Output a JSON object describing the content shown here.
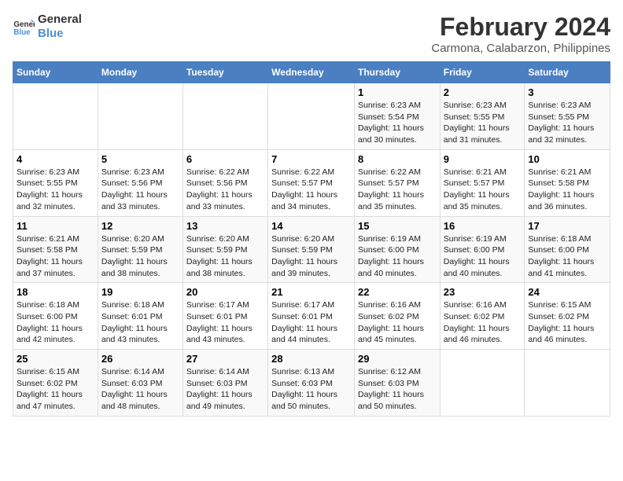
{
  "logo": {
    "line1": "General",
    "line2": "Blue"
  },
  "title": "February 2024",
  "subtitle": "Carmona, Calabarzon, Philippines",
  "days_of_week": [
    "Sunday",
    "Monday",
    "Tuesday",
    "Wednesday",
    "Thursday",
    "Friday",
    "Saturday"
  ],
  "weeks": [
    [
      {
        "day": "",
        "info": ""
      },
      {
        "day": "",
        "info": ""
      },
      {
        "day": "",
        "info": ""
      },
      {
        "day": "",
        "info": ""
      },
      {
        "day": "1",
        "info": "Sunrise: 6:23 AM\nSunset: 5:54 PM\nDaylight: 11 hours\nand 30 minutes."
      },
      {
        "day": "2",
        "info": "Sunrise: 6:23 AM\nSunset: 5:55 PM\nDaylight: 11 hours\nand 31 minutes."
      },
      {
        "day": "3",
        "info": "Sunrise: 6:23 AM\nSunset: 5:55 PM\nDaylight: 11 hours\nand 32 minutes."
      }
    ],
    [
      {
        "day": "4",
        "info": "Sunrise: 6:23 AM\nSunset: 5:55 PM\nDaylight: 11 hours\nand 32 minutes."
      },
      {
        "day": "5",
        "info": "Sunrise: 6:23 AM\nSunset: 5:56 PM\nDaylight: 11 hours\nand 33 minutes."
      },
      {
        "day": "6",
        "info": "Sunrise: 6:22 AM\nSunset: 5:56 PM\nDaylight: 11 hours\nand 33 minutes."
      },
      {
        "day": "7",
        "info": "Sunrise: 6:22 AM\nSunset: 5:57 PM\nDaylight: 11 hours\nand 34 minutes."
      },
      {
        "day": "8",
        "info": "Sunrise: 6:22 AM\nSunset: 5:57 PM\nDaylight: 11 hours\nand 35 minutes."
      },
      {
        "day": "9",
        "info": "Sunrise: 6:21 AM\nSunset: 5:57 PM\nDaylight: 11 hours\nand 35 minutes."
      },
      {
        "day": "10",
        "info": "Sunrise: 6:21 AM\nSunset: 5:58 PM\nDaylight: 11 hours\nand 36 minutes."
      }
    ],
    [
      {
        "day": "11",
        "info": "Sunrise: 6:21 AM\nSunset: 5:58 PM\nDaylight: 11 hours\nand 37 minutes."
      },
      {
        "day": "12",
        "info": "Sunrise: 6:20 AM\nSunset: 5:59 PM\nDaylight: 11 hours\nand 38 minutes."
      },
      {
        "day": "13",
        "info": "Sunrise: 6:20 AM\nSunset: 5:59 PM\nDaylight: 11 hours\nand 38 minutes."
      },
      {
        "day": "14",
        "info": "Sunrise: 6:20 AM\nSunset: 5:59 PM\nDaylight: 11 hours\nand 39 minutes."
      },
      {
        "day": "15",
        "info": "Sunrise: 6:19 AM\nSunset: 6:00 PM\nDaylight: 11 hours\nand 40 minutes."
      },
      {
        "day": "16",
        "info": "Sunrise: 6:19 AM\nSunset: 6:00 PM\nDaylight: 11 hours\nand 40 minutes."
      },
      {
        "day": "17",
        "info": "Sunrise: 6:18 AM\nSunset: 6:00 PM\nDaylight: 11 hours\nand 41 minutes."
      }
    ],
    [
      {
        "day": "18",
        "info": "Sunrise: 6:18 AM\nSunset: 6:00 PM\nDaylight: 11 hours\nand 42 minutes."
      },
      {
        "day": "19",
        "info": "Sunrise: 6:18 AM\nSunset: 6:01 PM\nDaylight: 11 hours\nand 43 minutes."
      },
      {
        "day": "20",
        "info": "Sunrise: 6:17 AM\nSunset: 6:01 PM\nDaylight: 11 hours\nand 43 minutes."
      },
      {
        "day": "21",
        "info": "Sunrise: 6:17 AM\nSunset: 6:01 PM\nDaylight: 11 hours\nand 44 minutes."
      },
      {
        "day": "22",
        "info": "Sunrise: 6:16 AM\nSunset: 6:02 PM\nDaylight: 11 hours\nand 45 minutes."
      },
      {
        "day": "23",
        "info": "Sunrise: 6:16 AM\nSunset: 6:02 PM\nDaylight: 11 hours\nand 46 minutes."
      },
      {
        "day": "24",
        "info": "Sunrise: 6:15 AM\nSunset: 6:02 PM\nDaylight: 11 hours\nand 46 minutes."
      }
    ],
    [
      {
        "day": "25",
        "info": "Sunrise: 6:15 AM\nSunset: 6:02 PM\nDaylight: 11 hours\nand 47 minutes."
      },
      {
        "day": "26",
        "info": "Sunrise: 6:14 AM\nSunset: 6:03 PM\nDaylight: 11 hours\nand 48 minutes."
      },
      {
        "day": "27",
        "info": "Sunrise: 6:14 AM\nSunset: 6:03 PM\nDaylight: 11 hours\nand 49 minutes."
      },
      {
        "day": "28",
        "info": "Sunrise: 6:13 AM\nSunset: 6:03 PM\nDaylight: 11 hours\nand 50 minutes."
      },
      {
        "day": "29",
        "info": "Sunrise: 6:12 AM\nSunset: 6:03 PM\nDaylight: 11 hours\nand 50 minutes."
      },
      {
        "day": "",
        "info": ""
      },
      {
        "day": "",
        "info": ""
      }
    ]
  ]
}
